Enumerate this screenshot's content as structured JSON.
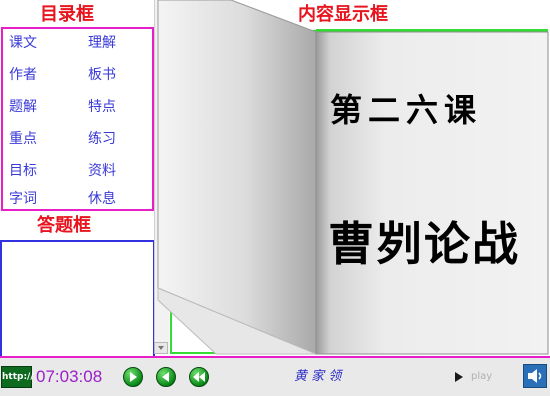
{
  "labels": {
    "menu": "目录框",
    "content": "内容显示框",
    "answer": "答题框"
  },
  "menu": {
    "items": [
      {
        "label": "课文"
      },
      {
        "label": "理解"
      },
      {
        "label": "作者"
      },
      {
        "label": "板书"
      },
      {
        "label": "题解"
      },
      {
        "label": "特点"
      },
      {
        "label": "重点"
      },
      {
        "label": "练习"
      },
      {
        "label": "目标"
      },
      {
        "label": "资料"
      },
      {
        "label": "字词"
      },
      {
        "label": "休息"
      }
    ]
  },
  "book": {
    "lesson": "第二六课",
    "title": "曹刿论战"
  },
  "footer": {
    "http_label": "http://",
    "clock": "07:03:08",
    "author": "黄 家 领",
    "play_label": "play"
  },
  "colors": {
    "label_red": "#e8141e",
    "menu_border": "#e81ec8",
    "answer_border": "#3232e0",
    "page_border": "#32dc32",
    "clock": "#9b1fc8"
  },
  "icons": [
    "prev-page-icon",
    "next-page-icon",
    "rewind-icon",
    "play-icon",
    "volume-icon"
  ]
}
